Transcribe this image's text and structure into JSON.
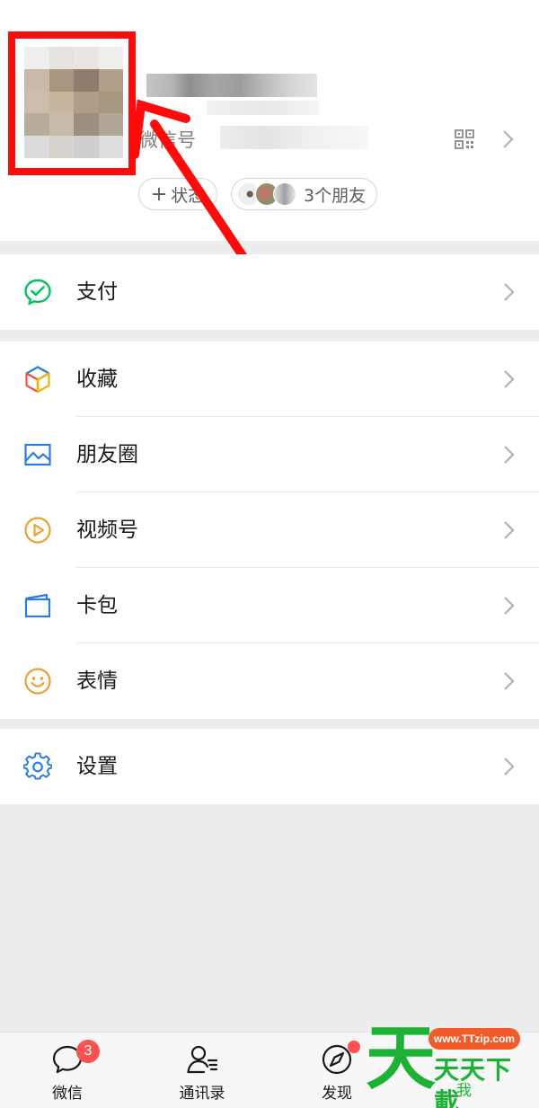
{
  "profile": {
    "wechat_id_label": "微信号",
    "status_button_label": "状态",
    "status_plus": "+",
    "friends_button_label": "3个朋友"
  },
  "menu": {
    "pay": {
      "label": "支付",
      "icon": "wechat-pay-icon"
    },
    "favorites": {
      "label": "收藏",
      "icon": "favorites-cube-icon"
    },
    "moments": {
      "label": "朋友圈",
      "icon": "moments-picture-icon"
    },
    "channels": {
      "label": "视频号",
      "icon": "channels-play-icon"
    },
    "cards": {
      "label": "卡包",
      "icon": "card-wallet-icon"
    },
    "stickers": {
      "label": "表情",
      "icon": "smiley-icon"
    },
    "settings": {
      "label": "设置",
      "icon": "gear-icon"
    }
  },
  "tabbar": {
    "chats": {
      "label": "微信",
      "badge": "3"
    },
    "contacts": {
      "label": "通讯录"
    },
    "discover": {
      "label": "发现"
    },
    "me": {
      "label": "我"
    }
  },
  "watermark": {
    "big": "天",
    "url": "www.TTzip.com",
    "sub": "天天下載"
  },
  "colors": {
    "highlight": "#ff0b0b",
    "wechat_green": "#07c160",
    "badge_red": "#fa5151",
    "favorites_blue": "#2a7de1",
    "channels_orange": "#f0a030",
    "stickers_orange": "#f0a030",
    "settings_blue": "#2a7de1",
    "watermark_green": "#1db235",
    "watermark_orange": "#f25c2a"
  }
}
